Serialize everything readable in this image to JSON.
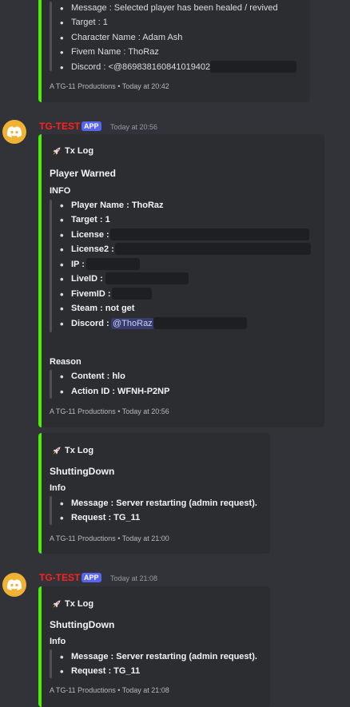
{
  "colors": {
    "background": "#313338",
    "embed_bg": "#2b2d31",
    "accent_bar": "#4ded0a",
    "username": "#ff2020",
    "app_badge": "#5865f2",
    "avatar": "#f0b232"
  },
  "embed0": {
    "items": [
      "Message : Selected player has been healed / revived",
      "Target : 1",
      "Character Name : Adam Ash",
      "Fivem Name : ThoRaz",
      "Discord : <@869838160841019402"
    ],
    "footer": "A TG-11 Productions • Today at 20:42"
  },
  "msg1": {
    "username": "TG-TEST",
    "app_badge": "APP",
    "timestamp": "Today at 20:56",
    "embed": {
      "author": "Tx Log",
      "title": "Player Warned",
      "field1_name": "INFO",
      "items": [
        "Player Name : ThoRaz",
        "Target : 1",
        "License :",
        "License2 :",
        "IP :",
        "LiveID :",
        "FivemID :",
        "Steam : not get",
        "Discord :"
      ],
      "discord_mention": "@ThoRaz",
      "field2_name": "Reason",
      "reason_items": [
        "Content : hlo",
        "Action ID : WFNH-P2NP"
      ],
      "footer": "A TG-11 Productions • Today at 20:56"
    }
  },
  "msg2": {
    "embed": {
      "author": "Tx Log",
      "title": "ShuttingDown",
      "field_name": "Info",
      "items": [
        "Message : Server restarting (admin request).",
        "Request : TG_11"
      ],
      "footer": "A TG-11 Productions • Today at 21:00"
    }
  },
  "msg3": {
    "username": "TG-TEST",
    "app_badge": "APP",
    "timestamp": "Today at 21:08",
    "embed": {
      "author": "Tx Log",
      "title": "ShuttingDown",
      "field_name": "Info",
      "items": [
        "Message : Server restarting (admin request).",
        "Request : TG_11"
      ],
      "footer": "A TG-11 Productions • Today at 21:08"
    }
  }
}
